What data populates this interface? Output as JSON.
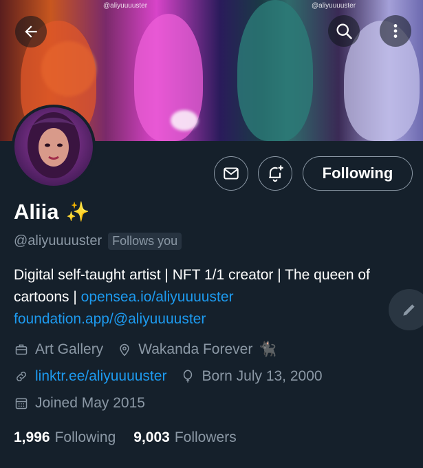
{
  "banner": {
    "watermark_left": "@aliyuuuuster",
    "watermark_right": "@aliyuuuuster"
  },
  "nav": {
    "back_icon": "arrow-left-icon",
    "search_icon": "search-icon",
    "more_icon": "more-vertical-icon"
  },
  "actions": {
    "message_icon": "envelope-icon",
    "notify_icon": "bell-plus-icon",
    "following_label": "Following"
  },
  "profile": {
    "name": "Aliia",
    "name_emoji": "✨",
    "handle": "@aliyuuuuster",
    "follows_you": "Follows you",
    "bio_text": "Digital self-taught artist | NFT 1/1 creator | The queen of cartoons | ",
    "bio_link_1": "opensea.io/aliyuuuuster",
    "bio_link_2": "foundation.app/@aliyuuuuster",
    "category": "Art Gallery",
    "location": "Wakanda Forever",
    "location_emoji": "🐈‍⬛",
    "website": "linktr.ee/aliyuuuuster",
    "birthday": "Born July 13, 2000",
    "joined": "Joined May 2015"
  },
  "stats": {
    "following_count": "1,996",
    "following_label": "Following",
    "followers_count": "9,003",
    "followers_label": "Followers"
  },
  "colors": {
    "background": "#15202b",
    "muted": "#8b98a5",
    "link": "#1d9bf0"
  }
}
